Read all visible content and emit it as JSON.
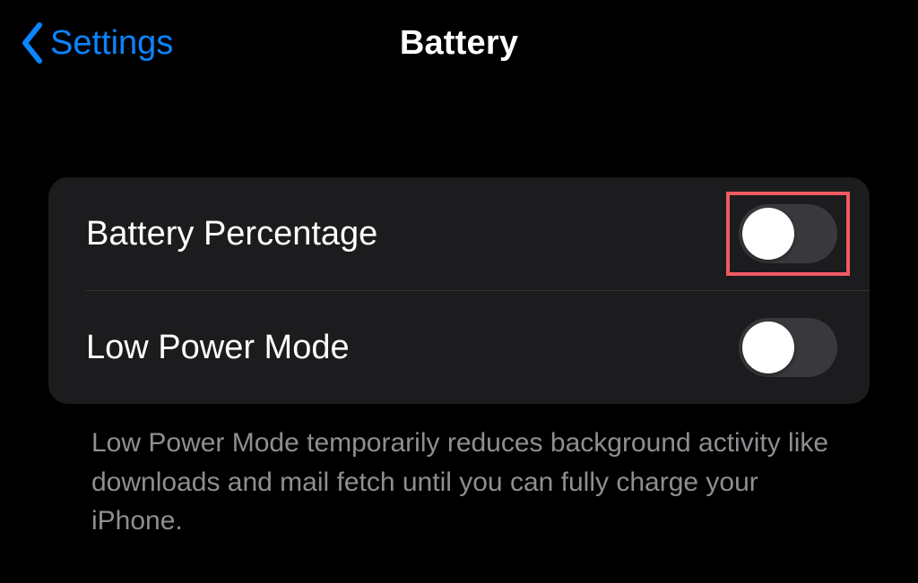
{
  "nav": {
    "back_label": "Settings",
    "title": "Battery"
  },
  "rows": {
    "battery_percentage": {
      "label": "Battery Percentage",
      "on": false
    },
    "low_power_mode": {
      "label": "Low Power Mode",
      "on": false
    }
  },
  "footer": "Low Power Mode temporarily reduces background activity like downloads and mail fetch until you can fully charge your iPhone.",
  "highlight": "battery_percentage",
  "colors": {
    "accent": "#0a84ff",
    "highlight_border": "#ef5a63"
  }
}
